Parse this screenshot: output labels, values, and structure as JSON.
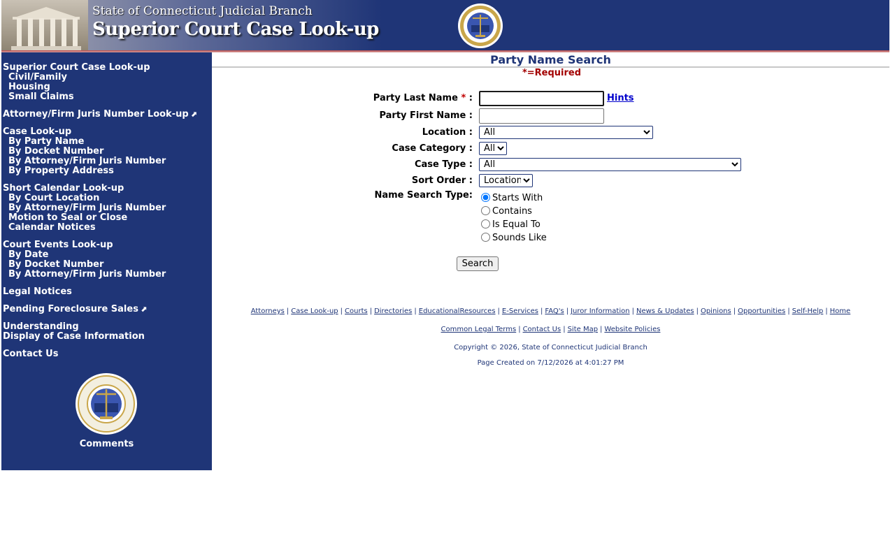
{
  "header": {
    "subtitle": "State of Connecticut Judicial Branch",
    "title": "Superior Court Case Look-up",
    "brand_color": "#1f3577"
  },
  "sidebar": {
    "groups": [
      {
        "title": "Superior Court Case Look-up",
        "items": [
          "Civil/Family",
          "Housing",
          "Small Claims"
        ]
      },
      {
        "title": "Attorney/Firm Juris Number Look-up",
        "external": true,
        "items": []
      },
      {
        "title": "Case Look-up",
        "items": [
          "By Party Name",
          "By Docket Number",
          "By Attorney/Firm Juris Number",
          "By Property Address"
        ]
      },
      {
        "title": "Short Calendar Look-up",
        "items": [
          "By Court Location",
          "By Attorney/Firm Juris Number",
          "Motion to Seal or Close",
          "Calendar Notices"
        ]
      },
      {
        "title": "Court Events Look-up",
        "items": [
          "By Date",
          "By Docket Number",
          "By Attorney/Firm Juris Number"
        ]
      },
      {
        "title": "Legal Notices",
        "items": []
      },
      {
        "title": "Pending Foreclosure Sales",
        "external": true,
        "items": []
      },
      {
        "title": "Understanding",
        "title2": "Display of Case Information",
        "items": []
      },
      {
        "title": "Contact Us",
        "items": []
      }
    ],
    "comments_label": "Comments",
    "external_icon": "external-link-icon"
  },
  "main": {
    "page_title": "Party Name Search",
    "required_note": "*=Required",
    "form": {
      "last_name_label": "Party Last Name",
      "required_star": "*",
      "label_suffix": " :",
      "last_name_value": "",
      "hints_label": "Hints",
      "first_name_label": "Party First Name :",
      "first_name_value": "",
      "location_label": "Location :",
      "location_value": "All",
      "category_label": "Case Category :",
      "category_value": "All",
      "type_label": "Case Type :",
      "type_value": "All",
      "sort_label": "Sort Order :",
      "sort_value": "Location",
      "name_type_label": "Name Search Type:",
      "name_types": [
        {
          "label": "Starts With",
          "checked": true
        },
        {
          "label": "Contains",
          "checked": false
        },
        {
          "label": "Is Equal To",
          "checked": false
        },
        {
          "label": "Sounds Like",
          "checked": false
        }
      ],
      "search_button": "Search"
    }
  },
  "footer": {
    "links_row1": [
      "Attorneys",
      "Case Look-up",
      "Courts",
      "Directories",
      "EducationalResources",
      "E-Services",
      "FAQ's",
      "Juror Information",
      "News & Updates",
      "Opinions",
      "Opportunities",
      "Self-Help",
      "Home"
    ],
    "links_row2": [
      "Common Legal Terms",
      "Contact Us",
      "Site Map",
      "Website Policies"
    ],
    "copyright": "Copyright © 2026, State of Connecticut Judicial Branch",
    "page_created": "Page Created on 7/12/2026 at 4:01:27 PM"
  }
}
